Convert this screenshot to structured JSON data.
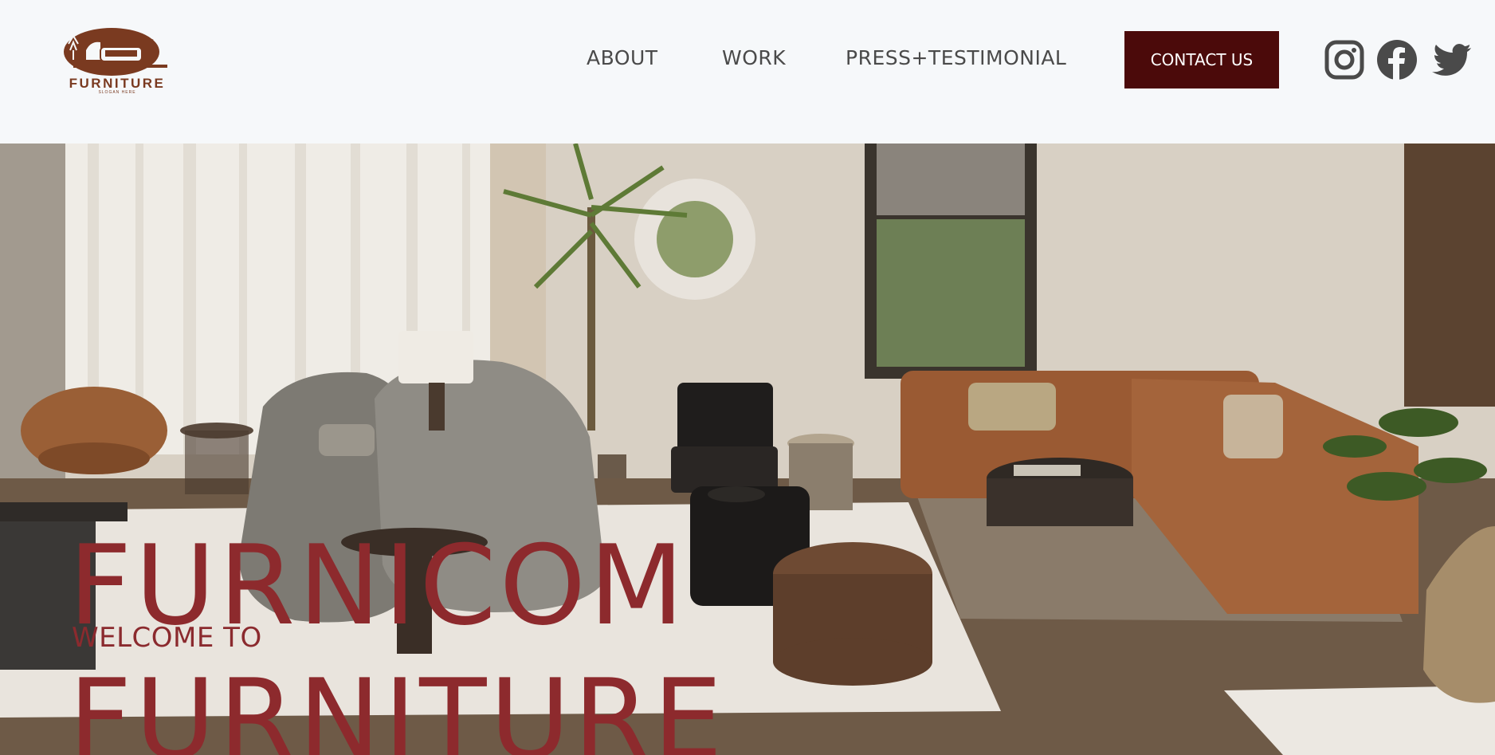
{
  "header": {
    "logo": {
      "wordmark": "FURNITURE",
      "tagline": "SLOGAN HERE"
    },
    "nav": [
      {
        "label": "ABOUT"
      },
      {
        "label": "WORK"
      },
      {
        "label": "PRESS+TESTIMONIAL"
      }
    ],
    "cta_label": "CONTACT US",
    "social_icons": [
      "instagram-icon",
      "facebook-icon",
      "twitter-icon"
    ]
  },
  "hero": {
    "welcome": "WELCOME TO",
    "title_line_1": "FURNICOM",
    "title_line_2": "FURNITURE"
  },
  "colors": {
    "background": "#f6f8fa",
    "cta_background": "#4b0a0a",
    "hero_text": "#8d2a2d",
    "nav_text": "#4a4a4a",
    "logo_brown": "#7a3a20"
  }
}
